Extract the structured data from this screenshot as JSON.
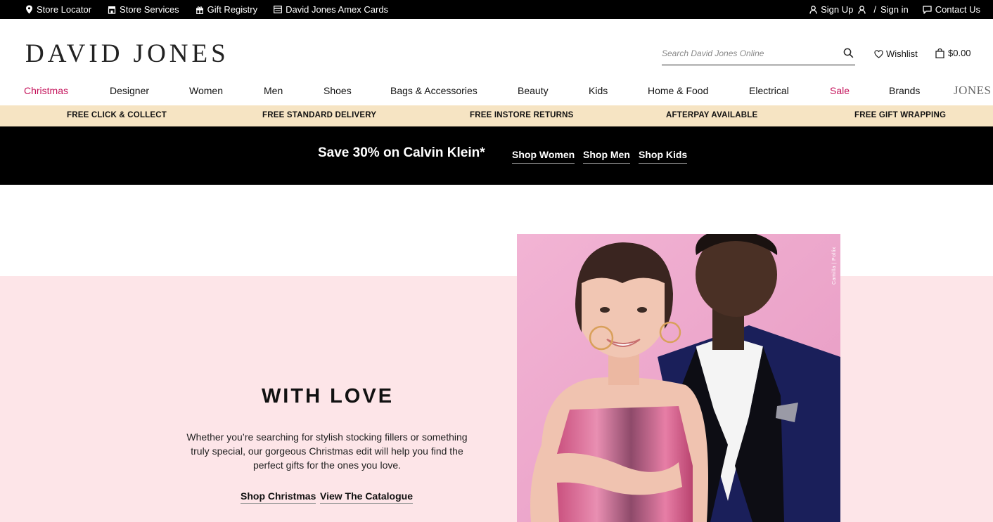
{
  "utility": {
    "left": [
      {
        "label": "Store Locator",
        "icon": "map-pin-icon"
      },
      {
        "label": "Store Services",
        "icon": "store-icon"
      },
      {
        "label": "Gift Registry",
        "icon": "gift-icon"
      },
      {
        "label": "David Jones Amex Cards",
        "icon": "card-icon"
      }
    ],
    "sign_up": "Sign Up",
    "separator": "/",
    "sign_in": "Sign in",
    "contact": "Contact Us"
  },
  "header": {
    "logo": "DAVID JONES",
    "search_placeholder": "Search David Jones Online",
    "wishlist": "Wishlist",
    "bag_total": "$0.00"
  },
  "nav": {
    "items": [
      "Christmas",
      "Designer",
      "Women",
      "Men",
      "Shoes",
      "Bags & Accessories",
      "Beauty",
      "Kids",
      "Home & Food",
      "Electrical",
      "Sale",
      "Brands"
    ],
    "jones_logo": "JONES",
    "accent_color": "#c4135b"
  },
  "benefits": [
    "FREE CLICK & COLLECT",
    "FREE STANDARD DELIVERY",
    "FREE INSTORE RETURNS",
    "AFTERPAY AVAILABLE",
    "FREE GIFT WRAPPING"
  ],
  "promo": {
    "text": "Save 30% on Calvin Klein*",
    "links": [
      "Shop Women",
      "Shop Men",
      "Shop Kids"
    ]
  },
  "hero": {
    "title": "WITH LOVE",
    "copy": "Whether you’re searching for stylish stocking fillers or something truly special, our gorgeous Christmas edit will help you find the perfect gifts for the ones you love.",
    "links": [
      "Shop Christmas",
      "View The Catalogue"
    ],
    "image_credit": "Camilla | Pollix",
    "background_color": "#fde5e8"
  }
}
